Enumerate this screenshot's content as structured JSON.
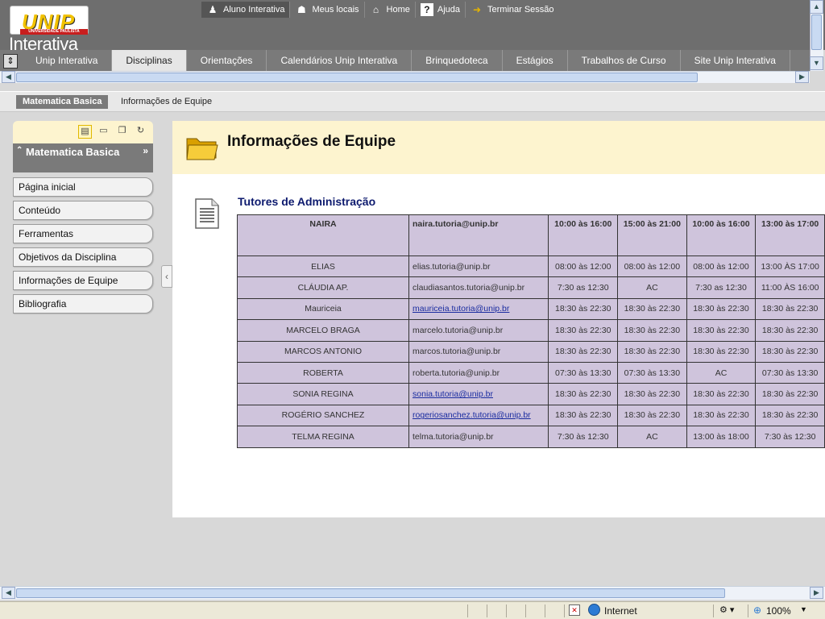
{
  "logo": {
    "brand": "UNIP",
    "strip": "UNIVERSIDADE PAULISTA",
    "name": "Interativa"
  },
  "toplinks": [
    {
      "label": "Aluno Interativa",
      "icon": "person-icon"
    },
    {
      "label": "Meus locais",
      "icon": "people-icon"
    },
    {
      "label": "Home",
      "icon": "home-icon"
    },
    {
      "label": "Ajuda",
      "icon": "help-icon"
    },
    {
      "label": "Terminar Sessão",
      "icon": "logout-icon"
    }
  ],
  "tabs": [
    {
      "label": "Unip Interativa"
    },
    {
      "label": "Disciplinas",
      "active": true
    },
    {
      "label": "Orientações"
    },
    {
      "label": "Calendários Unip Interativa"
    },
    {
      "label": "Brinquedoteca"
    },
    {
      "label": "Estágios"
    },
    {
      "label": "Trabalhos de Curso"
    },
    {
      "label": "Site Unip Interativa"
    }
  ],
  "breadcrumb": {
    "course": "Matematica Basica",
    "page": "Informações de Equipe"
  },
  "sidebar": {
    "course_title": "Matematica Basica",
    "items": [
      {
        "label": "Página inicial"
      },
      {
        "label": "Conteúdo"
      },
      {
        "label": "Ferramentas"
      },
      {
        "label": "Objetivos da Disciplina"
      },
      {
        "label": "Informações de Equipe"
      },
      {
        "label": "Bibliografia"
      }
    ]
  },
  "content": {
    "title": "Informações de Equipe",
    "section_title": "Tutores de Administração",
    "table": {
      "header": [
        "NAIRA",
        "naira.tutoria@unip.br",
        "10:00 às 16:00",
        "15:00 às 21:00",
        "10:00 às 16:00",
        "13:00 às 17:00"
      ],
      "rows": [
        {
          "name": "ELIAS",
          "email": "elias.tutoria@unip.br",
          "link": false,
          "t": [
            "08:00 às 12:00",
            "08:00 às 12:00",
            "08:00 às 12:00",
            "13:00 ÀS 17:00"
          ]
        },
        {
          "name": "CLÁUDIA  AP.",
          "email": "claudiasantos.tutoria@unip.br",
          "link": false,
          "t": [
            "7:30 as 12:30",
            "AC",
            "7:30 as 12:30",
            "11:00 ÀS 16:00"
          ]
        },
        {
          "name": "Mauriceia",
          "email": "mauriceia.tutoria@unip.br",
          "link": true,
          "t": [
            "18:30 às 22:30",
            "18:30 às 22:30",
            "18:30 às 22:30",
            "18:30 às 22:30"
          ]
        },
        {
          "name": "MARCELO BRAGA",
          "email": "marcelo.tutoria@unip.br",
          "link": false,
          "t": [
            "18:30 às 22:30",
            "18:30 às 22:30",
            "18:30 às 22:30",
            "18:30 às 22:30"
          ]
        },
        {
          "name": "MARCOS ANTONIO",
          "email": "marcos.tutoria@unip.br",
          "link": false,
          "t": [
            "18:30 às 22:30",
            "18:30 às 22:30",
            "18:30 às 22:30",
            "18:30 às 22:30"
          ]
        },
        {
          "name": "ROBERTA",
          "email": "roberta.tutoria@unip.br",
          "link": false,
          "t": [
            "07:30 às 13:30",
            "07:30 às 13:30",
            "AC",
            "07:30 às 13:30"
          ]
        },
        {
          "name": "SONIA REGINA",
          "email": "sonia.tutoria@unip.br",
          "link": true,
          "t": [
            "18:30 às 22:30",
            "18:30 às 22:30",
            "18:30 às 22:30",
            "18:30 às 22:30"
          ]
        },
        {
          "name": "ROGÉRIO SANCHEZ",
          "email": "rogeriosanchez.tutoria@unip.br",
          "link": true,
          "t": [
            "18:30 às 22:30",
            "18:30 às 22:30",
            "18:30 às 22:30",
            "18:30 às 22:30"
          ]
        },
        {
          "name": "TELMA REGINA",
          "email": "telma.tutoria@unip.br",
          "link": false,
          "t": [
            "7:30 às 12:30",
            "AC",
            "13:00 às 18:00",
            "7:30 às 12:30"
          ]
        }
      ]
    }
  },
  "statusbar": {
    "zone": "Internet",
    "zoom": "100%"
  },
  "colors": {
    "topbar": "#6e6e6e",
    "tabbar": "#7a7a7a",
    "header_bg": "#fdf4cf",
    "table_cell": "#cfc4dc",
    "section_title": "#0d1a6e"
  }
}
